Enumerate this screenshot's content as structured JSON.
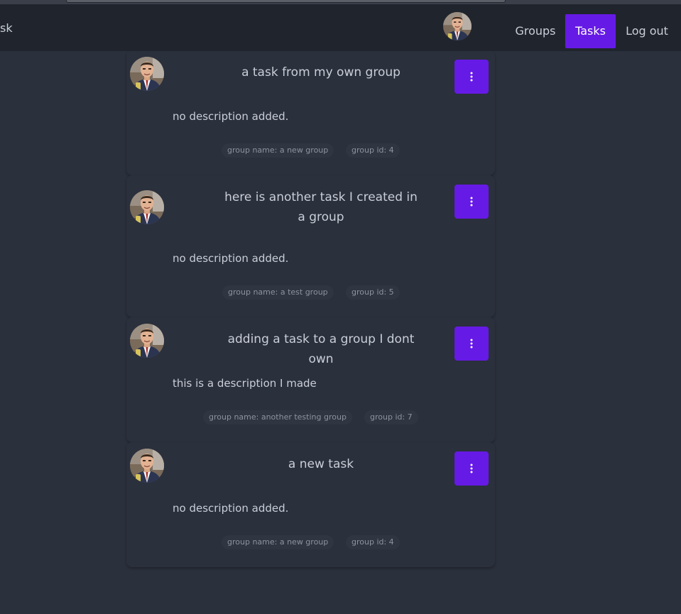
{
  "navbar": {
    "brand": "sk",
    "links": [
      {
        "label": "Groups"
      },
      {
        "label": "Tasks",
        "active": true
      },
      {
        "label": "Log out"
      }
    ]
  },
  "tasks": [
    {
      "title": "a task from my own group",
      "description": "no description added.",
      "group_name": "group name: a new group",
      "group_id": "group id: 4"
    },
    {
      "title": "here is another task I created in a group",
      "description": "no description added.",
      "group_name": "group name: a test group",
      "group_id": "group id: 5"
    },
    {
      "title": "adding a task to a group I dont own",
      "description": "this is a description I made",
      "group_name": "group name: another testing group",
      "group_id": "group id: 7"
    },
    {
      "title": "a new task",
      "description": "no description added.",
      "group_name": "group name: a new group",
      "group_id": "group id: 4"
    }
  ],
  "icons": {
    "avatar": "user-avatar-photo",
    "menu": "vertical-dots-icon"
  },
  "colors": {
    "accent": "#661ae6",
    "background": "#2a303c",
    "navbar": "#20252d"
  }
}
